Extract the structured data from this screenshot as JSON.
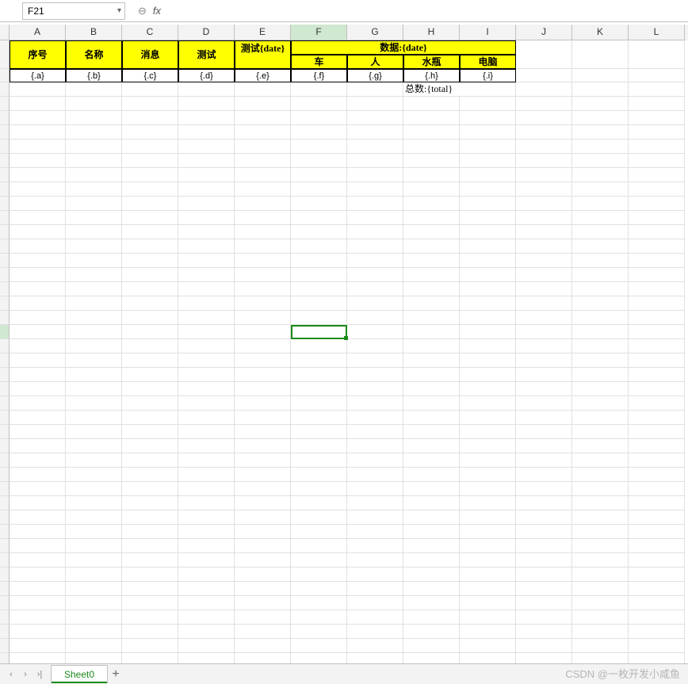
{
  "namebox": {
    "value": "F21"
  },
  "fx": {
    "label": "fx",
    "value": ""
  },
  "columns": [
    "A",
    "B",
    "C",
    "D",
    "E",
    "F",
    "G",
    "H",
    "I",
    "J",
    "K",
    "L"
  ],
  "active_column_index": 5,
  "active_cell": "F21",
  "active_row_index": 20,
  "template": {
    "row1": {
      "A": "序号",
      "B": "名称",
      "C": "消息",
      "D": "测试",
      "E": "测试{date}",
      "merge_F_I": "数据:{date}",
      "sub": {
        "F": "车",
        "G": "人",
        "H": "水瓶",
        "I": "电脑"
      }
    },
    "row3": {
      "A": "{.a}",
      "B": "{.b}",
      "C": "{.c}",
      "D": "{.d}",
      "E": "{.e}",
      "F": "{.f}",
      "G": "{.g}",
      "H": "{.h}",
      "I": "{.i}"
    },
    "row4_HI": "总数:{total}"
  },
  "sheet": {
    "name": "Sheet0"
  },
  "nav": {
    "first": "|‹",
    "prev": "‹",
    "next": "›",
    "last": "›|",
    "add": "+"
  },
  "watermark": "CSDN @一枚开发小咸鱼"
}
